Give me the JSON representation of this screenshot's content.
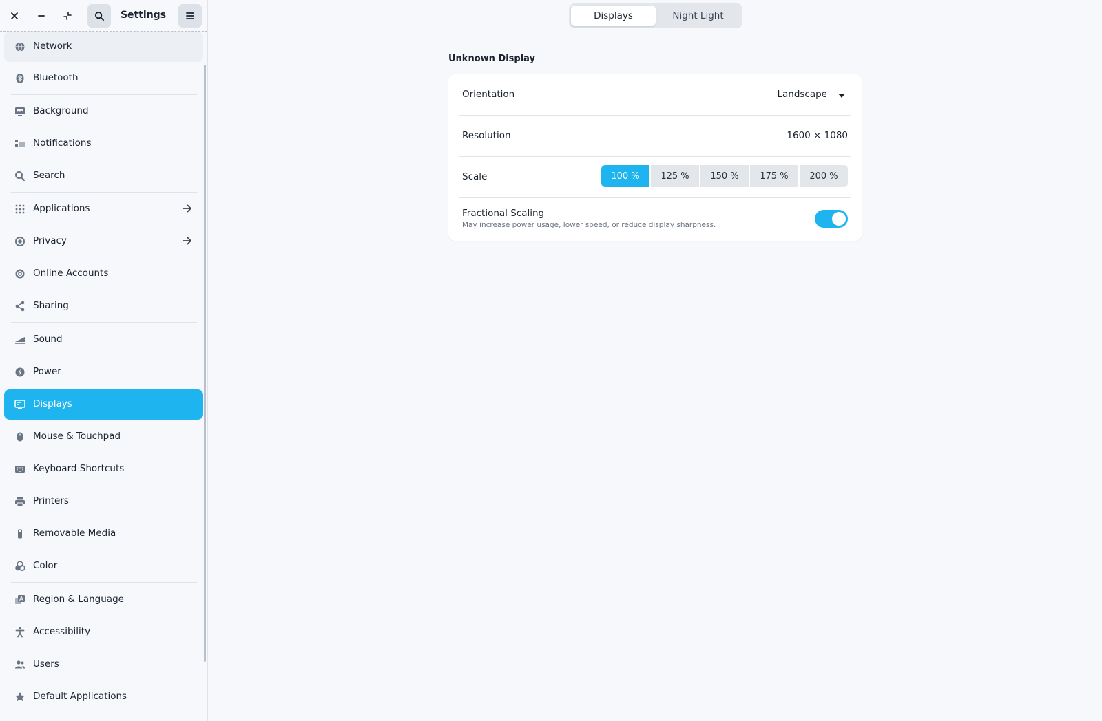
{
  "window": {
    "title": "Settings"
  },
  "sidebar": {
    "items": [
      {
        "label": "Network",
        "icon": "globe-icon"
      },
      {
        "label": "Bluetooth",
        "icon": "bluetooth-icon"
      },
      {
        "label": "Background",
        "icon": "monitor-image-icon"
      },
      {
        "label": "Notifications",
        "icon": "notifications-icon"
      },
      {
        "label": "Search",
        "icon": "search-icon"
      },
      {
        "label": "Applications",
        "icon": "grid-icon"
      },
      {
        "label": "Privacy",
        "icon": "privacy-icon"
      },
      {
        "label": "Online Accounts",
        "icon": "at-icon"
      },
      {
        "label": "Sharing",
        "icon": "share-icon"
      },
      {
        "label": "Sound",
        "icon": "sound-icon"
      },
      {
        "label": "Power",
        "icon": "power-icon"
      },
      {
        "label": "Displays",
        "icon": "display-icon"
      },
      {
        "label": "Mouse & Touchpad",
        "icon": "mouse-icon"
      },
      {
        "label": "Keyboard Shortcuts",
        "icon": "keyboard-icon"
      },
      {
        "label": "Printers",
        "icon": "printer-icon"
      },
      {
        "label": "Removable Media",
        "icon": "usb-icon"
      },
      {
        "label": "Color",
        "icon": "color-icon"
      },
      {
        "label": "Region & Language",
        "icon": "language-icon"
      },
      {
        "label": "Accessibility",
        "icon": "accessibility-icon"
      },
      {
        "label": "Users",
        "icon": "users-icon"
      },
      {
        "label": "Default Applications",
        "icon": "star-icon"
      }
    ],
    "active": "Displays"
  },
  "view_switcher": {
    "tabs": [
      "Displays",
      "Night Light"
    ],
    "active": "Displays"
  },
  "display": {
    "name": "Unknown Display",
    "orientation_label": "Orientation",
    "orientation_value": "Landscape",
    "resolution_label": "Resolution",
    "resolution_value": "1600 × 1080",
    "scale_label": "Scale",
    "scale_options": [
      "100 %",
      "125 %",
      "150 %",
      "175 %",
      "200 %"
    ],
    "scale_selected": "100 %",
    "fractional_label": "Fractional Scaling",
    "fractional_sub": "May increase power usage, lower speed, or reduce display sharpness.",
    "fractional_enabled": true
  },
  "colors": {
    "accent": "#1eb4f0",
    "background": "#f6f8fb",
    "card": "#ffffff"
  }
}
